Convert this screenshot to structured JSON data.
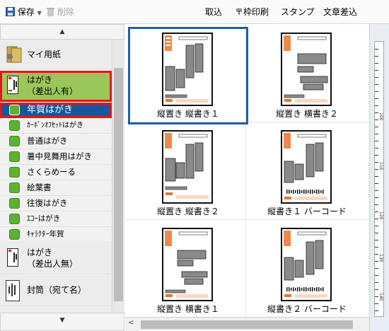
{
  "toolbar": {
    "save_label": "保存",
    "delete_label": "削除",
    "import_label": "取込",
    "zip_print_label": "〒枠印刷",
    "stamp_label": "スタンプ",
    "text_insert_label": "文章差込"
  },
  "sidebar": {
    "categories": [
      {
        "label": "マイ用紙",
        "icon": "folder-icon"
      },
      {
        "label_line1": "はがき",
        "label_line2": "（差出人有）",
        "icon": "postcard-icon",
        "selected": true
      },
      {
        "label_line1": "はがき",
        "label_line2": "（差出人無）",
        "icon": "postcard-icon"
      },
      {
        "label": "封筒（宛て名）",
        "icon": "envelope-icon"
      }
    ],
    "subitems": [
      {
        "label": "年賀はがき",
        "selected": true
      },
      {
        "label": "ｶｰﾎﾞﾝｵﾌｾｯﾄはがき"
      },
      {
        "label": "普通はがき"
      },
      {
        "label": "暑中見舞用はがき"
      },
      {
        "label": "さくらめーる"
      },
      {
        "label": "絵葉書"
      },
      {
        "label": "往復はがき"
      },
      {
        "label": "ｴｺｰはがき"
      },
      {
        "label": "ｷｬﾗｸﾀｰ年賀"
      }
    ]
  },
  "templates": [
    {
      "caption": "縦置き 縦書き１",
      "selected": true
    },
    {
      "caption": "縦置き 横書き２"
    },
    {
      "caption": "縦置き 縦書き２"
    },
    {
      "caption": "縦書き１ バーコード"
    },
    {
      "caption": "縦置き 横書き１"
    },
    {
      "caption": "縦書き２ バーコード"
    }
  ],
  "ruler": {
    "labels": [
      "100",
      "110",
      "120",
      "130",
      "140"
    ]
  },
  "colors": {
    "selected_blue": "#0f5a9c",
    "selected_green": "#9bc65a",
    "highlight_red": "#e8141b",
    "stamp_orange": "#e8742a"
  }
}
